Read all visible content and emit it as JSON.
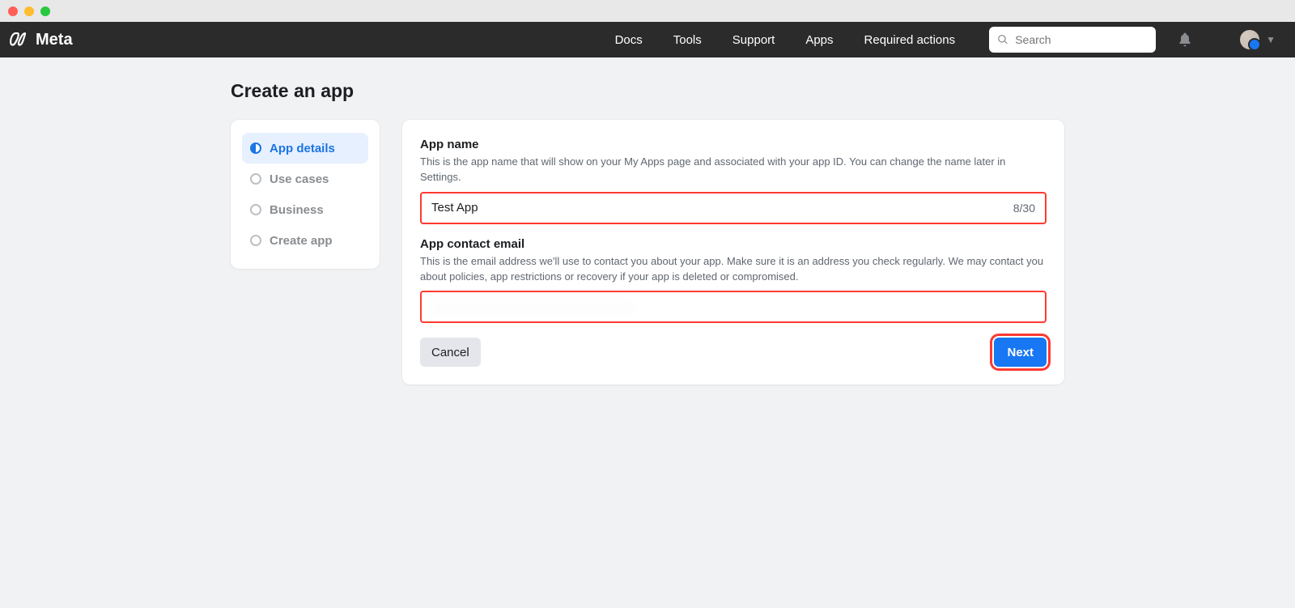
{
  "chrome": {},
  "brand": {
    "name": "Meta"
  },
  "nav": {
    "links": [
      "Docs",
      "Tools",
      "Support",
      "Apps",
      "Required actions"
    ]
  },
  "search": {
    "placeholder": "Search",
    "value": ""
  },
  "page": {
    "title": "Create an app"
  },
  "stepper": {
    "items": [
      {
        "label": "App details",
        "active": true
      },
      {
        "label": "Use cases",
        "active": false
      },
      {
        "label": "Business",
        "active": false
      },
      {
        "label": "Create app",
        "active": false
      }
    ]
  },
  "form": {
    "appName": {
      "label": "App name",
      "desc": "This is the app name that will show on your My Apps page and associated with your app ID. You can change the name later in Settings.",
      "value": "Test App",
      "counter": "8/30"
    },
    "contactEmail": {
      "label": "App contact email",
      "desc": "This is the email address we'll use to contact you about your app. Make sure it is an address you check regularly. We may contact you about policies, app restrictions or recovery if your app is deleted or compromised.",
      "value": ""
    },
    "actions": {
      "cancel": "Cancel",
      "next": "Next"
    }
  }
}
